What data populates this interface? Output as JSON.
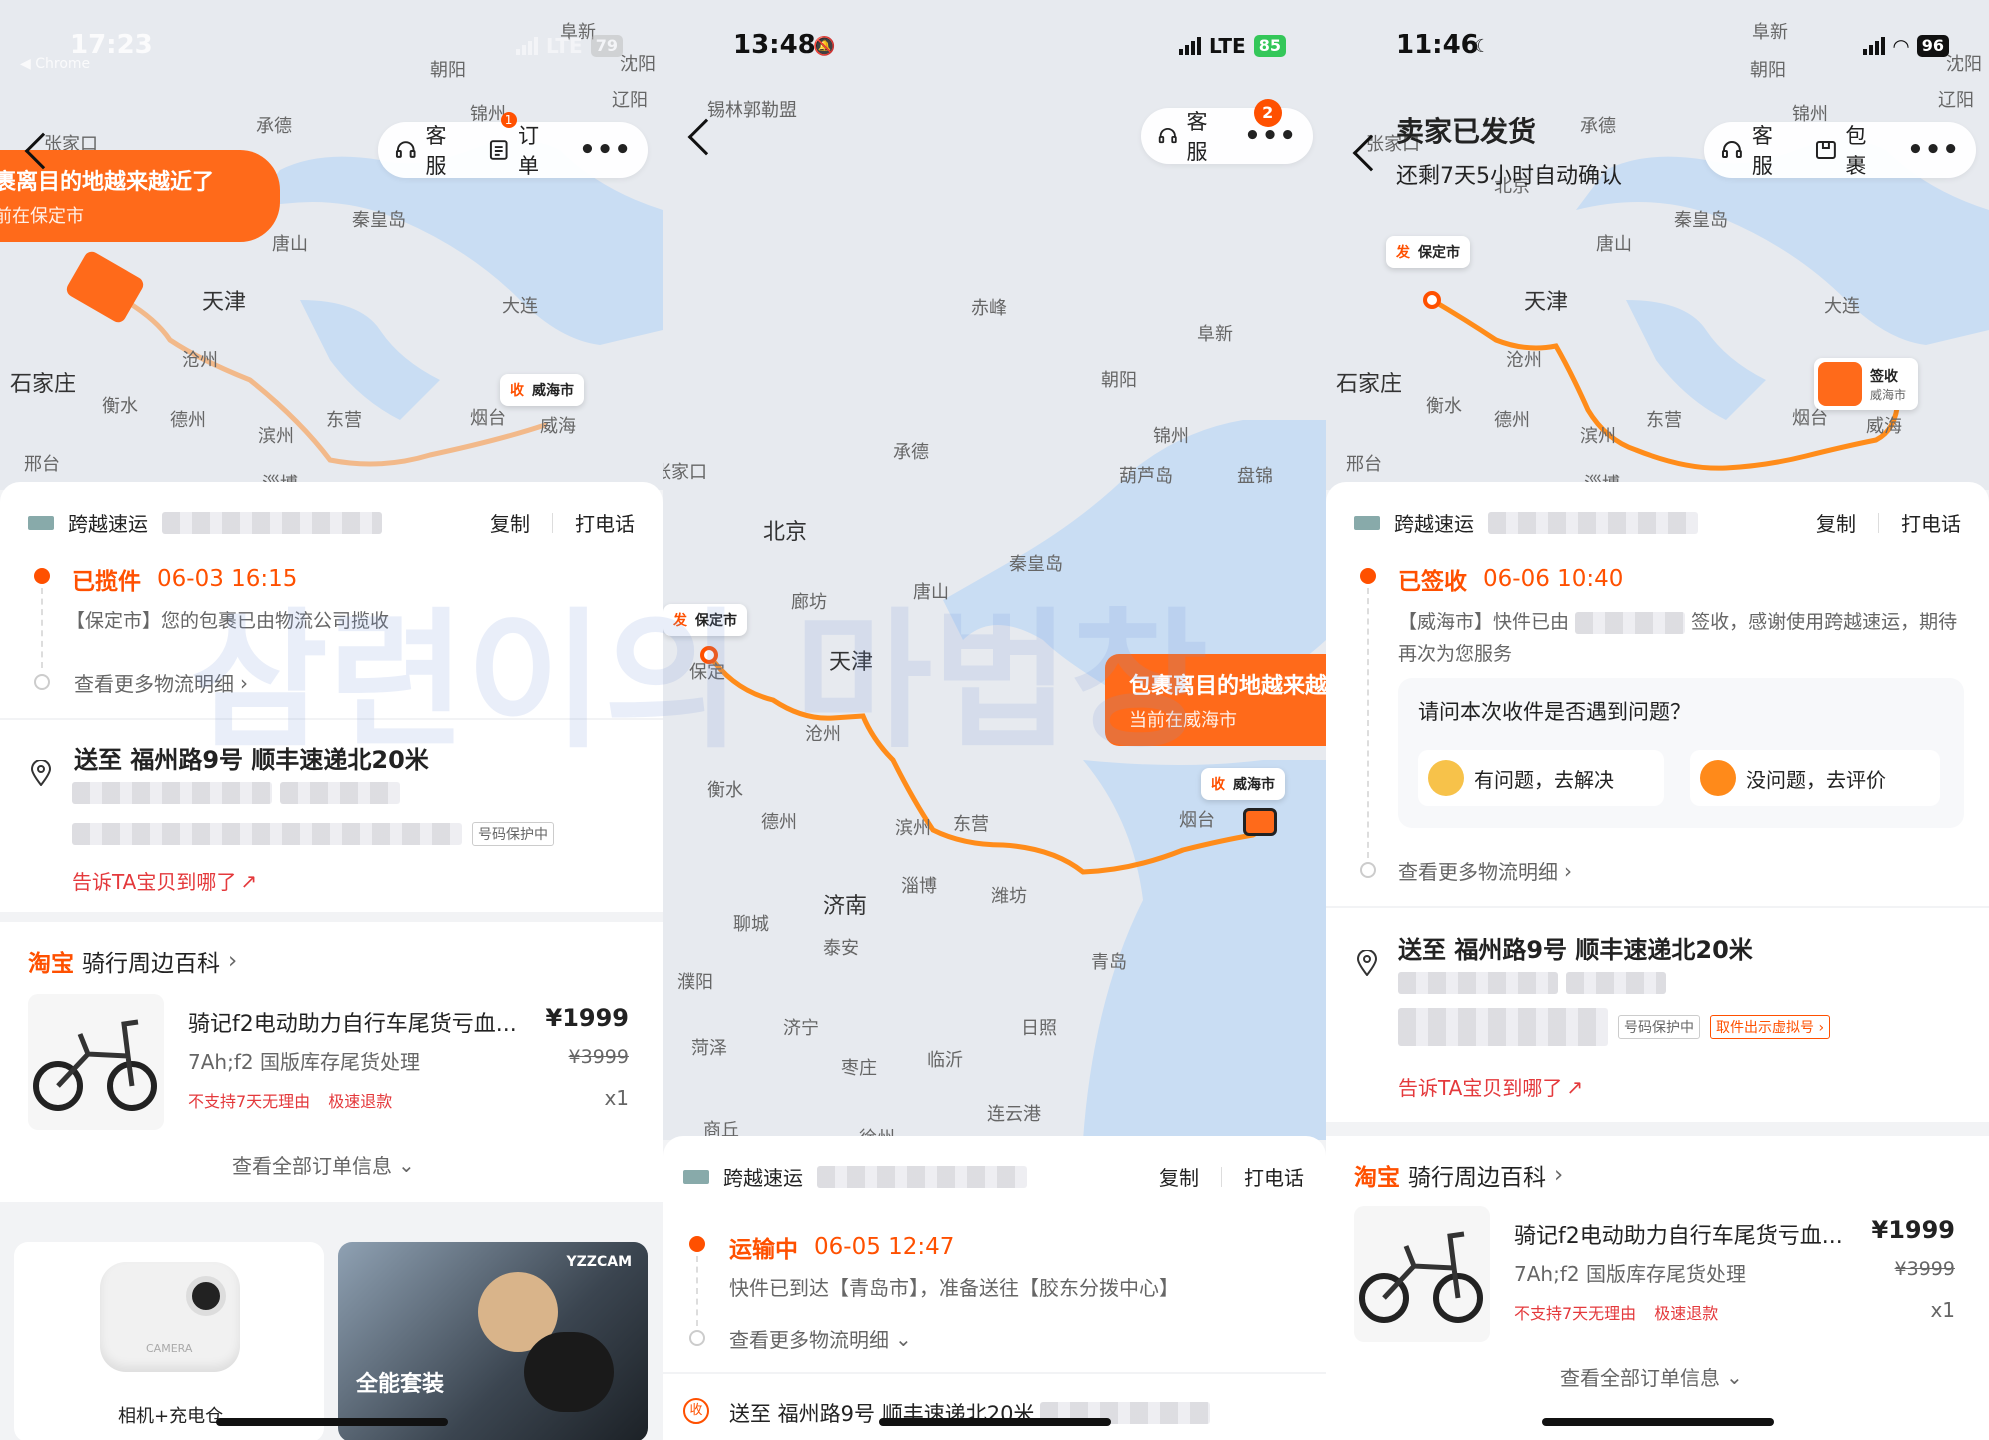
{
  "panel1": {
    "status": {
      "time": "17:23",
      "sub": "◀ Chrome",
      "net": "LTE",
      "battery": "79"
    },
    "nav": {
      "service": "客服",
      "orders": "订单",
      "orders_badge": "1",
      "more": "•••"
    },
    "banner": {
      "title": "裹离目的地越来越近了",
      "sub": "前在保定市"
    },
    "map_cities": [
      "张家口",
      "承德",
      "锦州",
      "朝阳",
      "阜新",
      "沈阳",
      "辽阳",
      "秦皇岛",
      "唐山",
      "天津",
      "大连",
      "石家庄",
      "沧州",
      "衡水",
      "德州",
      "滨州",
      "东营",
      "烟台",
      "邢台",
      "淄博",
      "威海"
    ],
    "receive_tag": {
      "k": "收",
      "city": "威海市"
    },
    "carrier": {
      "name": "跨越速运",
      "copy": "复制",
      "call": "打电话"
    },
    "event": {
      "status": "已揽件",
      "time": "06-03 16:15",
      "text": "【保定市】您的包裹已由物流公司揽收",
      "more": "查看更多物流明细"
    },
    "address": {
      "line": "送至 福州路9号 顺丰速递北20米",
      "protect": "号码保护中",
      "tell": "告诉TA宝贝到哪了"
    },
    "shop": {
      "brand": "淘宝",
      "name": "骑行周边百科"
    },
    "product": {
      "title": "骑记f2电动助力自行车尾货亏血...",
      "price": "¥1999",
      "spec": "7Ah;f2 国版库存尾货处理",
      "orig": "¥3999",
      "t1": "不支持7天无理由",
      "t2": "极速退款",
      "qty": "x1"
    },
    "view_all": "查看全部订单信息",
    "recs": [
      {
        "label": "相机+充电仓",
        "brand": "CAMERA"
      },
      {
        "label": "全能套装",
        "brand": "YZZCAM"
      }
    ]
  },
  "panel2": {
    "status": {
      "time": "13:48",
      "net": "LTE",
      "battery": "85"
    },
    "nav": {
      "service": "客服",
      "badge": "2",
      "more": "•••"
    },
    "banner": {
      "title": "包裹离目的地越来越",
      "sub": "当前在威海市"
    },
    "send_tag": {
      "k": "发",
      "city": "保定市"
    },
    "receive_tag": {
      "k": "收",
      "city": "威海市"
    },
    "map_cities": [
      "锡林郭勒盟",
      "赤峰",
      "阜新",
      "朝阳",
      "锦州",
      "承德",
      "葫芦岛",
      "盘锦",
      "北京",
      "秦皇岛",
      "唐山",
      "廊坊",
      "天津",
      "保定",
      "沧州",
      "衡水",
      "德州",
      "滨州",
      "东营",
      "烟台",
      "淄博",
      "潍坊",
      "济南",
      "聊城",
      "泰安",
      "青岛",
      "濮阳",
      "济宁",
      "日照",
      "菏泽",
      "临沂",
      "枣庄",
      "连云港",
      "商丘",
      "徐州",
      "张家口"
    ],
    "carrier": {
      "name": "跨越速运",
      "copy": "复制",
      "call": "打电话"
    },
    "event": {
      "status": "运输中",
      "time": "06-05 12:47",
      "text": "快件已到达【青岛市】，准备送往【胶东分拨中心】",
      "more": "查看更多物流明细"
    },
    "address": {
      "line": "送至 福州路9号 顺丰速递北20米"
    }
  },
  "panel3": {
    "status": {
      "time": "11:46",
      "battery": "96"
    },
    "header": {
      "title": "卖家已发货",
      "sub": "还剩7天5小时自动确认"
    },
    "nav": {
      "service": "客服",
      "package": "包裹",
      "more": "•••"
    },
    "send_tag": {
      "k": "发",
      "city": "保定市"
    },
    "sign_tag": {
      "title": "签收",
      "city": "威海市"
    },
    "map_cities": [
      "朝阳",
      "阜新",
      "沈阳",
      "辽阳",
      "承德",
      "锦州",
      "北京",
      "张家口",
      "秦皇岛",
      "唐山",
      "天津",
      "大连",
      "石家庄",
      "沧州",
      "衡水",
      "德州",
      "滨州",
      "东营",
      "烟台",
      "邢台",
      "淄博",
      "威海"
    ],
    "carrier": {
      "name": "跨越速运",
      "copy": "复制",
      "call": "打电话"
    },
    "event": {
      "status": "已签收",
      "time": "06-06 10:40",
      "text": "【威海市】快件已由",
      "text2": "签收，感谢使用跨越速运，期待再次为您服务",
      "more": "查看更多物流明细"
    },
    "question": {
      "title": "请问本次收件是否遇到问题？",
      "bad": "有问题，去解决",
      "good": "没问题，去评价"
    },
    "address": {
      "line": "送至 福州路9号 顺丰速递北20米",
      "protect": "号码保护中",
      "virtual": "取件出示虚拟号",
      "tell": "告诉TA宝贝到哪了"
    },
    "shop": {
      "brand": "淘宝",
      "name": "骑行周边百科"
    },
    "product": {
      "title": "骑记f2电动助力自行车尾货亏血...",
      "price": "¥1999",
      "spec": "7Ah;f2 国版库存尾货处理",
      "orig": "¥3999",
      "t1": "不支持7天无理由",
      "t2": "极速退款",
      "qty": "x1"
    },
    "view_all": "查看全部订单信息"
  },
  "watermark": "삼련이의 마법창"
}
